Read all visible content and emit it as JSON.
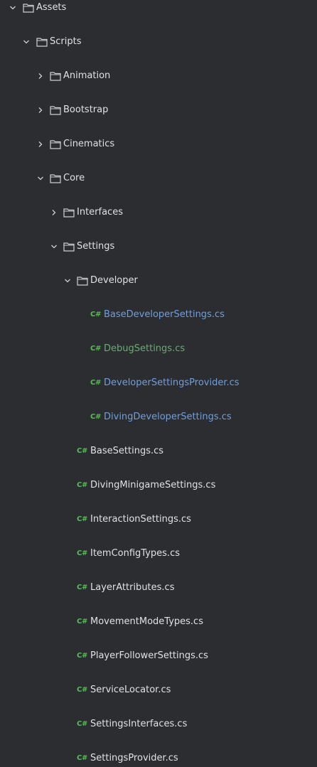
{
  "tree": {
    "assets": "Assets",
    "scripts": "Scripts",
    "animation": "Animation",
    "bootstrap": "Bootstrap",
    "cinematics": "Cinematics",
    "core": "Core",
    "interfaces": "Interfaces",
    "settings": "Settings",
    "developer": "Developer",
    "dev_files": [
      "BaseDeveloperSettings.cs",
      "DebugSettings.cs",
      "DeveloperSettingsProvider.cs",
      "DivingDeveloperSettings.cs"
    ],
    "settings_files": [
      "BaseSettings.cs",
      "DivingMinigameSettings.cs",
      "InteractionSettings.cs",
      "ItemConfigTypes.cs",
      "LayerAttributes.cs",
      "MovementModeTypes.cs",
      "PlayerFollowerSettings.cs",
      "ServiceLocator.cs",
      "SettingsInterfaces.cs",
      "SettingsProvider.cs"
    ],
    "cs_badge": "C#"
  },
  "colors": {
    "background": "#2b2d30",
    "text": "#dfe1e5",
    "modified_blue": "#6f9fe0",
    "new_green": "#6aab73",
    "cs_badge": "#5fb85f"
  },
  "icons": {
    "expanded": "chevron-down-icon",
    "collapsed": "chevron-right-icon",
    "folder": "folder-icon",
    "file": "csharp-file-icon"
  }
}
